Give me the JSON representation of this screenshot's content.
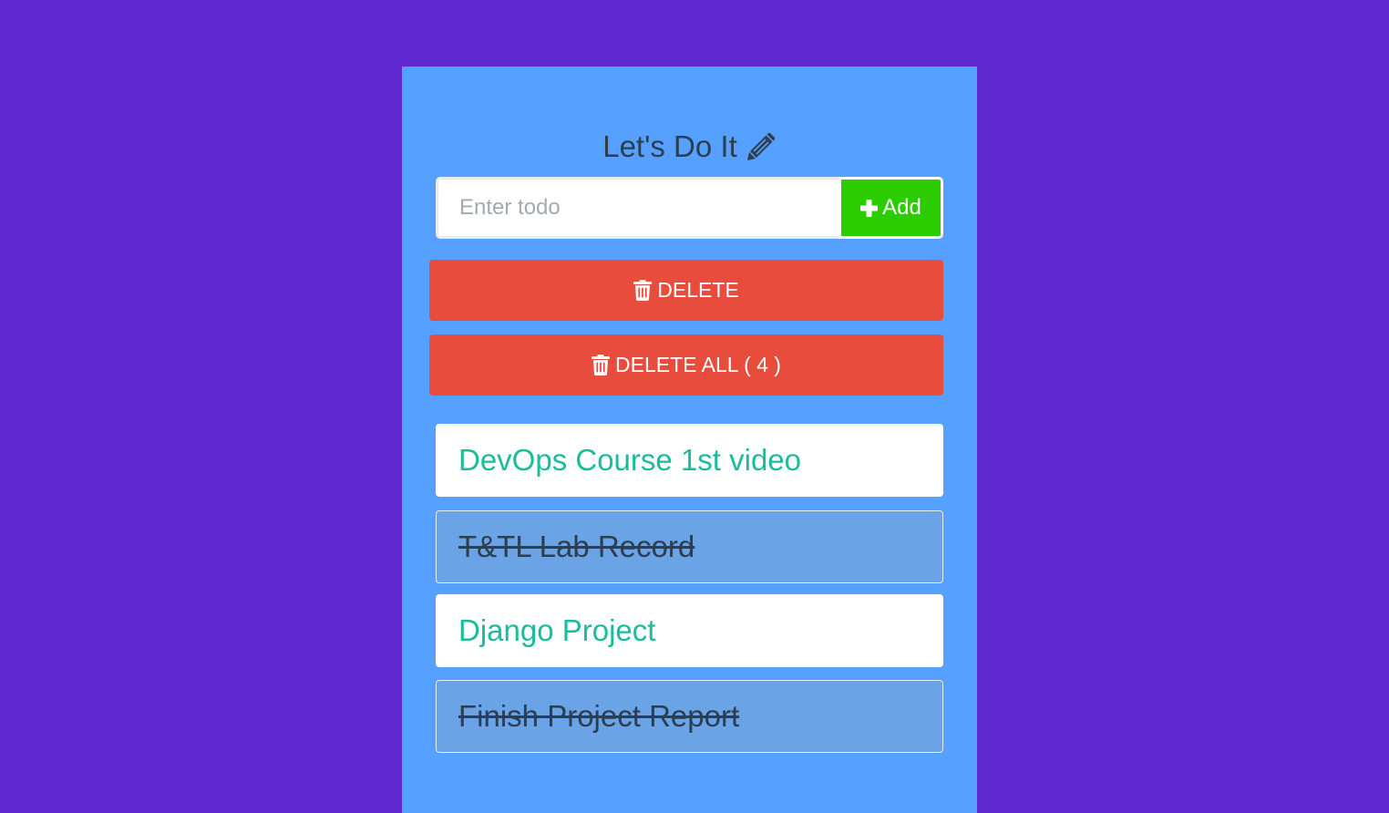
{
  "header": {
    "title": "Let's Do It",
    "title_icon": "pencil-icon"
  },
  "form": {
    "input_value": "",
    "input_placeholder": "Enter todo",
    "add_label": "Add",
    "add_icon": "plus-icon"
  },
  "actions": {
    "delete_label": "DELETE",
    "delete_all_label": "DELETE ALL ( 4 )",
    "icon": "trash-icon"
  },
  "todos": [
    {
      "text": "DevOps Course 1st video",
      "completed": false
    },
    {
      "text": "T&TL Lab Record",
      "completed": true
    },
    {
      "text": "Django Project",
      "completed": false
    },
    {
      "text": "Finish Project Report",
      "completed": true
    }
  ],
  "colors": {
    "page_background": "#5e27cf",
    "card_background": "#56a0ff",
    "add_button": "#2ccc00",
    "delete_button": "#e74c3c",
    "active_text": "#1abc9c",
    "completed_background": "#6aa3e6",
    "title_text": "#2c3e50"
  }
}
